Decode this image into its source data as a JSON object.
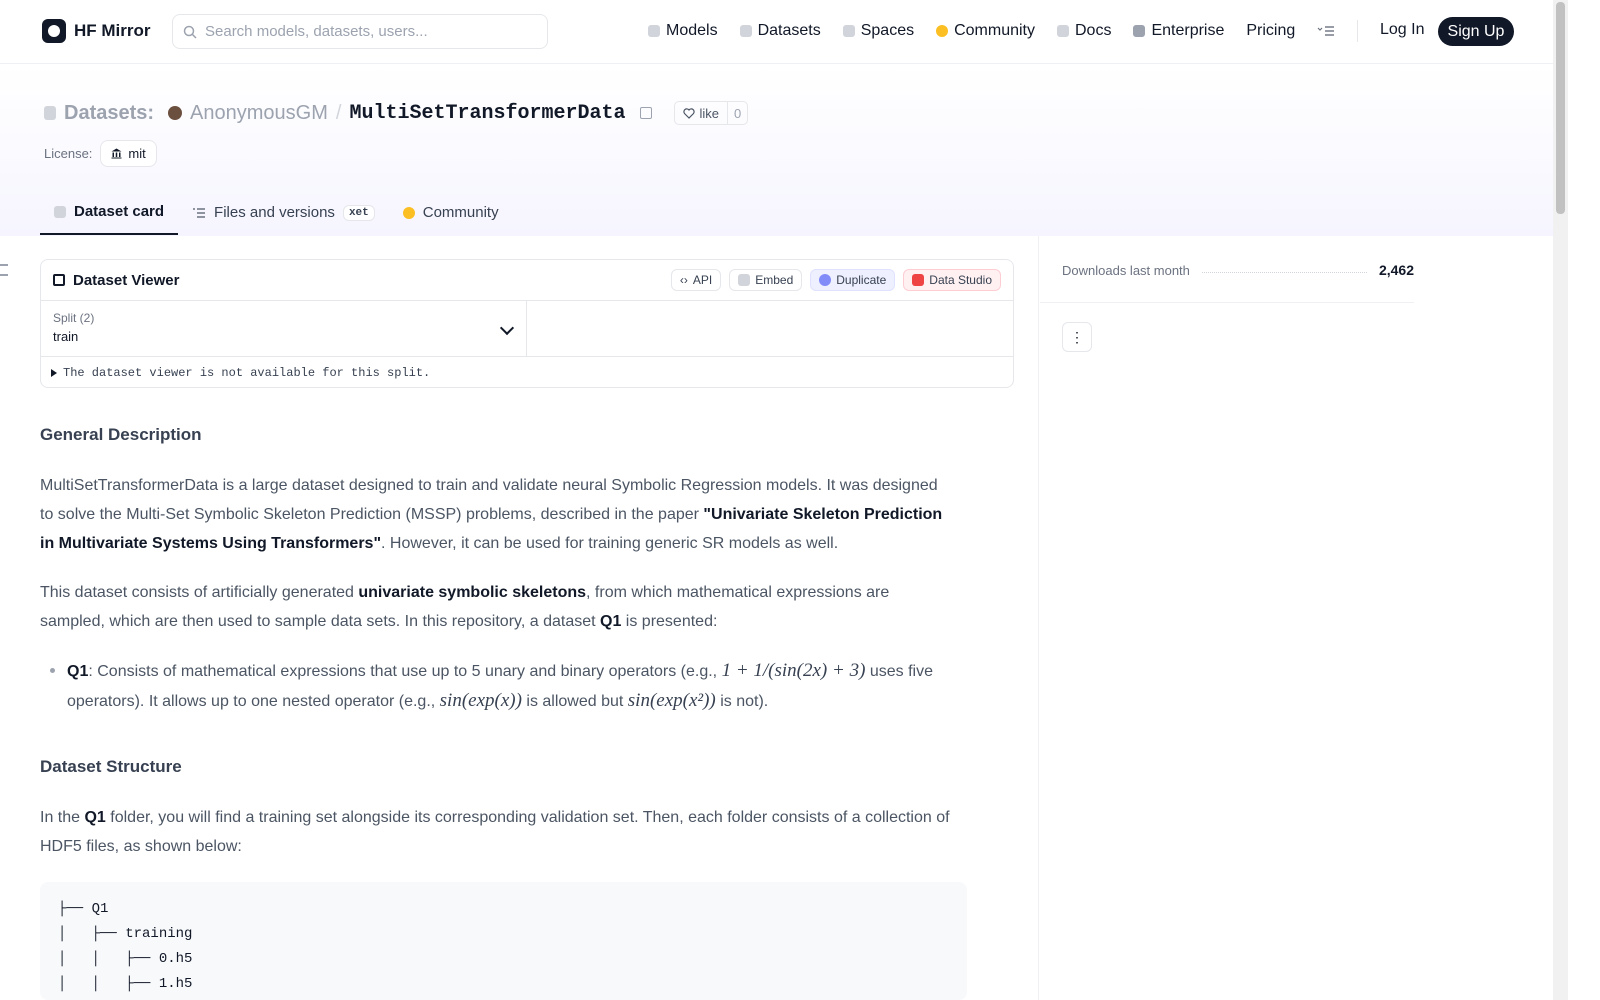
{
  "nav": {
    "brand": "HF Mirror",
    "search_placeholder": "Search models, datasets, users...",
    "links": [
      "Models",
      "Datasets",
      "Spaces",
      "Community",
      "Docs",
      "Enterprise",
      "Pricing"
    ],
    "login": "Log In",
    "signup": "Sign Up"
  },
  "header": {
    "type_label": "Datasets:",
    "owner": "AnonymousGM",
    "repo": "MultiSetTransformerData",
    "like_label": "like",
    "like_count": "0",
    "license_label": "License:",
    "license_value": "mit"
  },
  "tabs": [
    {
      "label": "Dataset card"
    },
    {
      "label": "Files and versions",
      "badge": "xet"
    },
    {
      "label": "Community"
    }
  ],
  "viewer": {
    "title": "Dataset Viewer",
    "buttons": [
      "API",
      "Embed",
      "Duplicate",
      "Data Studio"
    ],
    "split_label": "Split (2)",
    "split_value": "train",
    "note": "The dataset viewer is not available for this split."
  },
  "content": {
    "h_general": "General Description",
    "p1a": "MultiSetTransformerData is a large dataset designed to train and validate neural Symbolic Regression models. It was designed to solve the Multi-Set Symbolic Skeleton Prediction (MSSP) problems, described in the paper ",
    "p1b": "\"Univariate Skeleton Prediction in Multivariate Systems Using Transformers\"",
    "p1c": ". However, it can be used for training generic SR models as well.",
    "p2a": "This dataset consists of artificially generated ",
    "p2b": "univariate symbolic skeletons",
    "p2c": ", from which mathematical expressions are sampled, which are then used to sample data sets. In this repository, a dataset ",
    "p2d": "Q1",
    "p2e": " is presented:",
    "b1a": "Q1",
    "b1b": ": Consists of mathematical expressions that use up to 5 unary and binary operators (e.g., ",
    "m1": "1 + 1/(sin(2x) + 3)",
    "b1c": " uses five operators). It allows up to one nested operator (e.g., ",
    "m2": "sin(exp(x))",
    "b1d": " is allowed but ",
    "m3": "sin(exp(x²))",
    "b1e": " is not).",
    "h_structure": "Dataset Structure",
    "p3a": "In the ",
    "p3b": "Q1",
    "p3c": " folder, you will find a training set alongside its corresponding validation set. Then, each folder consists of a collection of HDF5 files, as shown below:",
    "code": "├── Q1\n│   ├── training\n│   │   ├── 0.h5\n│   │   ├── 1.h5"
  },
  "sidebar": {
    "downloads_label": "Downloads last month",
    "downloads_value": "2,462",
    "more_icon": "⋮"
  }
}
